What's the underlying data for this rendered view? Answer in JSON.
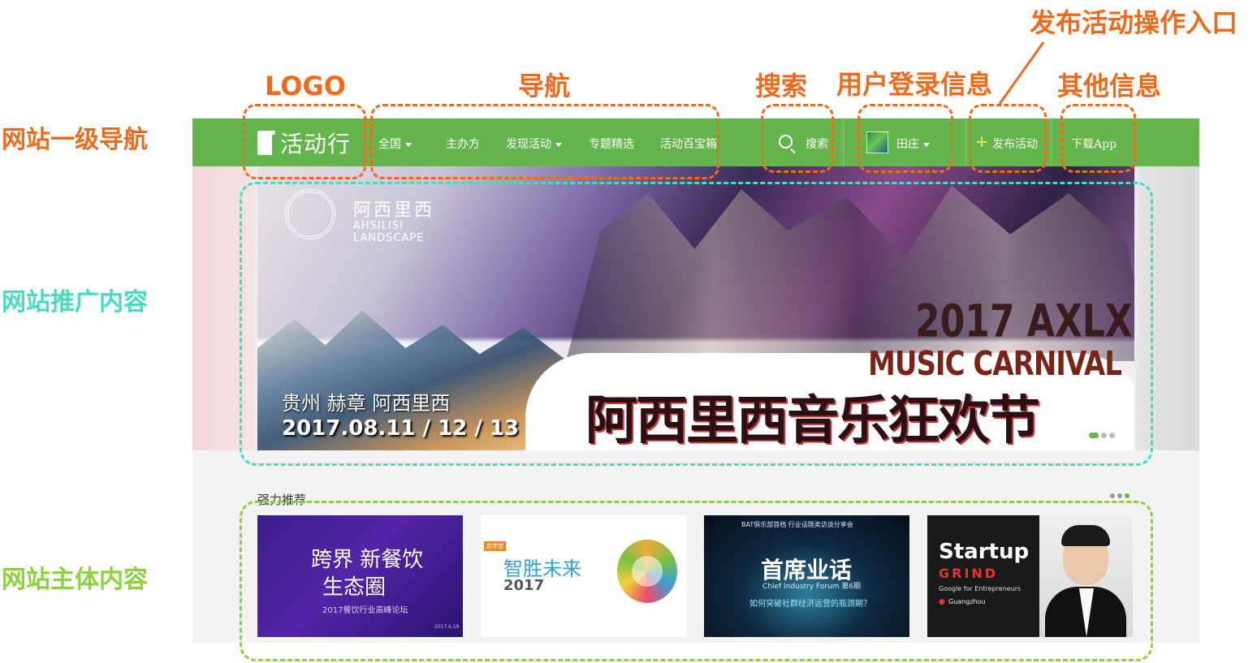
{
  "annotations": {
    "logo": "LOGO",
    "nav": "导航",
    "search": "搜索",
    "user_login": "用户登录信息",
    "publish_entry": "发布活动操作入口",
    "other_info": "其他信息",
    "primary_nav": "网站一级导航",
    "promo_content": "网站推广内容",
    "main_content": "网站主体内容"
  },
  "colors": {
    "annotation_orange": "#f06a1a",
    "annotation_teal": "#46dcc0",
    "annotation_green": "#8cd23c",
    "navbar_green": "#65b54d"
  },
  "navbar": {
    "logo_text": "活动行",
    "logo_icon": "door-logo-icon",
    "items": [
      {
        "label": "全国",
        "dropdown": true
      },
      {
        "label": "主办方",
        "dropdown": false
      },
      {
        "label": "发现活动",
        "dropdown": true
      },
      {
        "label": "专题精选",
        "dropdown": false
      },
      {
        "label": "活动百宝箱",
        "dropdown": false
      }
    ],
    "search_label": "搜索",
    "user_name": "田庄",
    "publish_label": "发布活动",
    "download_label": "下载App"
  },
  "banner": {
    "brand_cn": "阿西里西",
    "brand_en_line1": "AHSILISI",
    "brand_en_line2": "LANDSCAPE",
    "year": "2017",
    "event_short": "AXLX",
    "event_en": "MUSIC CARNIVAL",
    "event_cn": "阿西里西音乐狂欢节",
    "location": "贵州  赫章  阿西里西",
    "dates": "2017.08.11 / 12 / 13",
    "slide_count": 3,
    "active_slide": 1
  },
  "recommended": {
    "title": "强力推荐",
    "cards": [
      {
        "title_line1": "跨界 新餐饮",
        "title_line2": "生态圈",
        "subtitle": "2017餐饮行业高峰论坛",
        "date": "2017.6.18"
      },
      {
        "badge": "启学宝",
        "title": "智胜未来",
        "year": "2017"
      },
      {
        "tag": "BAT俱乐部首档 行业话题类访谈分享会",
        "title": "首席业话",
        "title_en": "Chief Industry Forum 第6期",
        "question": "如何突破社群经济运营的瓶颈期？"
      },
      {
        "brand_line1": "Startup",
        "brand_line2": "GRIND",
        "powered": "Google for Entrepreneurs",
        "city": "Guangzhou"
      }
    ]
  }
}
